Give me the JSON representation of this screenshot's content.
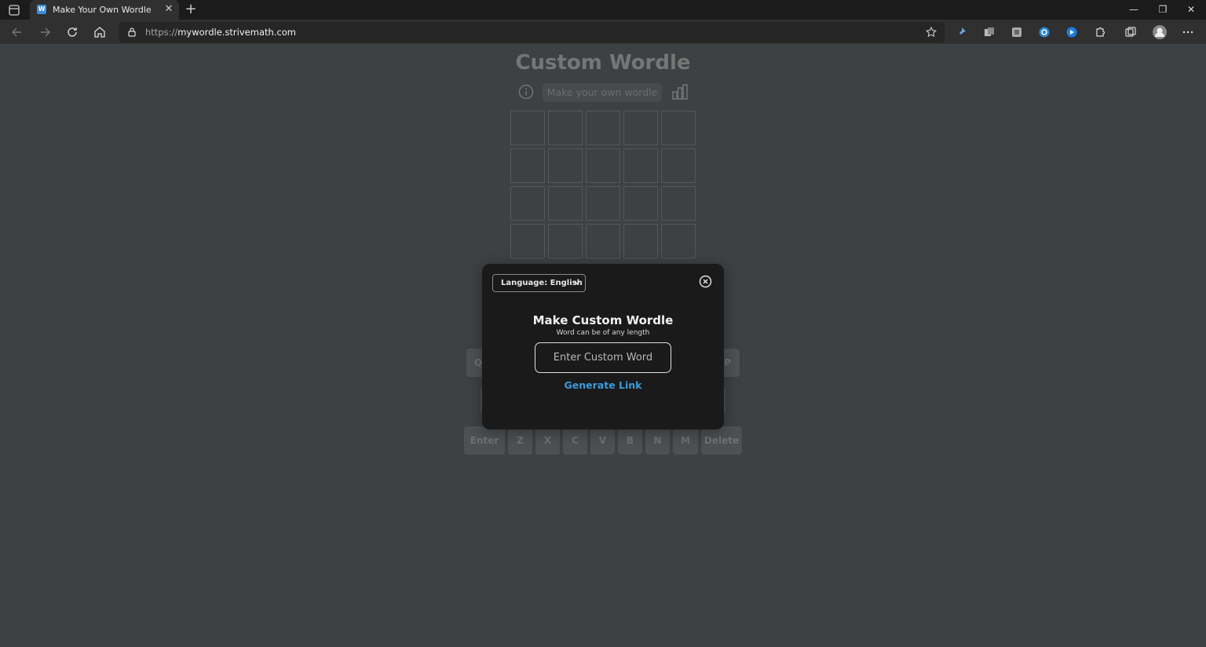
{
  "browser": {
    "tab_title": "Make Your Own Wordle",
    "tab_favicon_letter": "W",
    "tab_close": "✕",
    "new_tab": "+",
    "url_scheme": "https://",
    "url_host": "mywordle.strivemath.com",
    "window_controls": {
      "minimize": "—",
      "restore": "❐",
      "close": "✕"
    }
  },
  "page": {
    "title": "Custom Wordle",
    "make_own_label": "Make your own wordle"
  },
  "keyboard": {
    "row1_left": "Q",
    "row1_right": "P",
    "row3": [
      "Enter",
      "Z",
      "X",
      "C",
      "V",
      "B",
      "N",
      "M",
      "Delete"
    ]
  },
  "modal": {
    "language_select": "Language: English",
    "title": "Make Custom Wordle",
    "subtitle": "Word can be of any length",
    "input_placeholder": "Enter Custom Word",
    "generate_link": "Generate Link"
  },
  "colors": {
    "page_bg": "#3d4144",
    "modal_bg": "#1a1a1b",
    "link": "#3c9ad8"
  }
}
